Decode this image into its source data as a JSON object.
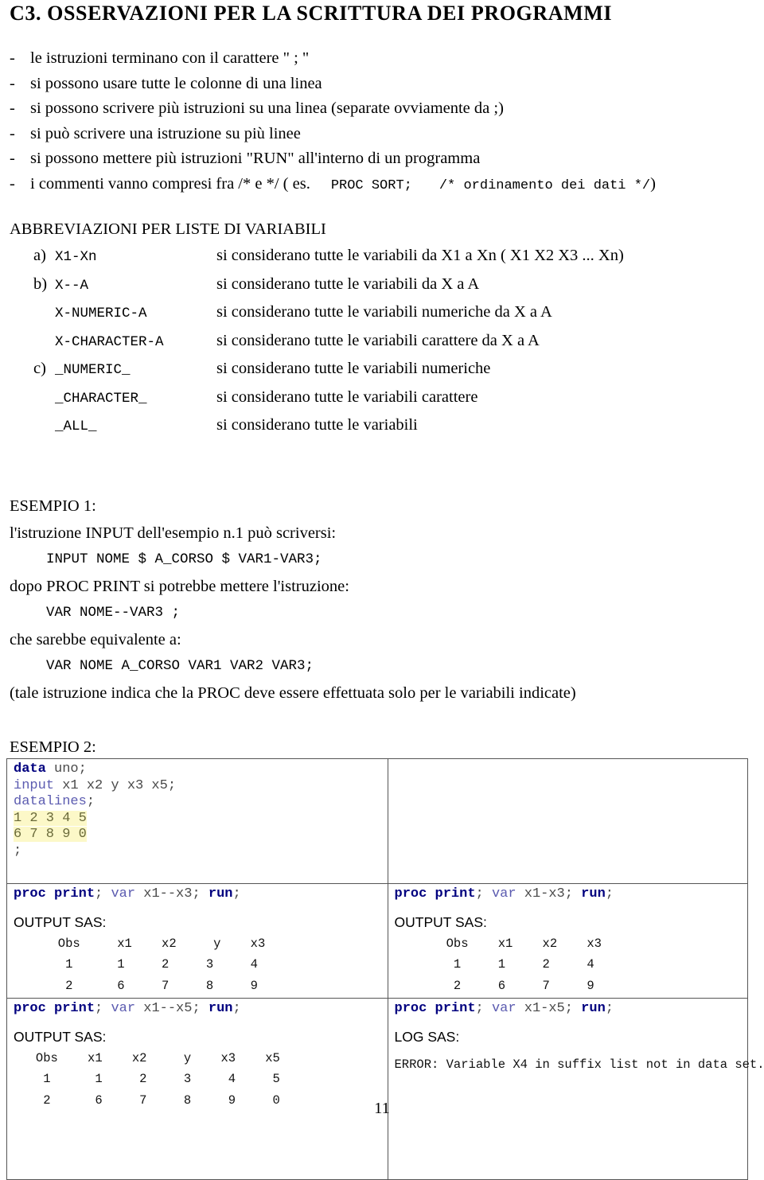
{
  "document": {
    "title": "C3. OSSERVAZIONI PER LA SCRITTURA DEI PROGRAMMI",
    "page_number": "11"
  },
  "bullets": {
    "dash": "-",
    "items": [
      {
        "text": "le istruzioni terminano con il carattere \" ; \""
      },
      {
        "text": "si possono usare tutte le colonne di una linea"
      },
      {
        "text": "si possono scrivere più istruzioni su una linea (separate ovviamente da ;)"
      },
      {
        "text": "si può scrivere una istruzione su più linee"
      },
      {
        "text": "si possono mettere più istruzioni \"RUN\" all'interno di un programma"
      }
    ],
    "comment_item": {
      "prefix": "i commenti vanno compresi fra /* e */ ( es.",
      "code": "PROC SORT;",
      "comment": "/* ordinamento dei dati */",
      "suffix": ")"
    }
  },
  "abbreviations": {
    "heading": "ABBREVIAZIONI PER LISTE DI VARIABILI",
    "rows": [
      {
        "marker": "a)",
        "code": "X1-Xn",
        "desc": "si considerano tutte le variabili da X1 a Xn    ( X1 X2 X3 ... Xn)"
      },
      {
        "marker": "b)",
        "code": "X--A",
        "desc": "si considerano tutte le variabili da X a A"
      },
      {
        "marker": "",
        "code": "X-NUMERIC-A",
        "desc": "si considerano tutte le variabili numeriche da X a A"
      },
      {
        "marker": "",
        "code": "X-CHARACTER-A",
        "desc": "si considerano tutte le variabili carattere da X a A"
      },
      {
        "marker": "c)",
        "code": "_NUMERIC_",
        "desc": "si considerano tutte le variabili numeriche"
      },
      {
        "marker": "",
        "code": "_CHARACTER_",
        "desc": "si considerano tutte le variabili carattere"
      },
      {
        "marker": "",
        "code": "_ALL_",
        "desc": "si considerano tutte le variabili"
      }
    ]
  },
  "esempio1": {
    "label": "ESEMPIO 1:",
    "line1": "l'istruzione INPUT dell'esempio n.1  può scriversi:",
    "code1": "INPUT NOME $ A_CORSO $ VAR1-VAR3;",
    "line2": "dopo PROC PRINT si potrebbe mettere l'istruzione:",
    "code2": "VAR NOME--VAR3 ;",
    "line3": "che sarebbe equivalente a:",
    "code3": "VAR NOME A_CORSO VAR1 VAR2 VAR3;",
    "line4": "(tale istruzione indica che la PROC deve essere effettuata solo per le variabili indicate)"
  },
  "esempio2": {
    "label": "ESEMPIO 2:",
    "left": {
      "data_step": {
        "kw_data": "data",
        "dataset": " uno;",
        "kw_input": "input",
        "input_vars": " x1 x2 y x3 x5;",
        "kw_datalines": "datalines",
        "datalines_semi": ";",
        "data_rows": [
          "1 2 3 4 5",
          "6 7 8 9 0"
        ],
        "terminator": ";"
      },
      "proc1": {
        "kw1": "proc print",
        "semi1": "; ",
        "kw_var": "var",
        "args": " x1--x3; ",
        "kw_run": "run",
        "semi2": ";"
      },
      "output1_label": "OUTPUT SAS:",
      "output1_header": "      Obs     x1    x2     y    x3",
      "output1_rows": [
        "       1      1     2     3     4",
        "       2      6     7     8     9"
      ],
      "proc2": {
        "kw1": "proc print",
        "semi1": "; ",
        "kw_var": "var",
        "args": " x1--x5; ",
        "kw_run": "run",
        "semi2": ";"
      },
      "output2_label": "OUTPUT SAS:",
      "output2_header": "   Obs    x1    x2     y    x3    x5",
      "output2_rows": [
        "    1      1     2     3     4     5",
        "    2      6     7     8     9     0"
      ]
    },
    "right": {
      "proc1": {
        "kw1": "proc print",
        "semi1": "; ",
        "kw_var": "var",
        "args": " x1-x3; ",
        "kw_run": "run",
        "semi2": ";"
      },
      "output1_label": "OUTPUT SAS:",
      "output1_header": "       Obs    x1    x2    x3",
      "output1_rows": [
        "        1     1     2     4",
        "        2     6     7     9"
      ],
      "proc2": {
        "kw1": "proc print",
        "semi1": "; ",
        "kw_var": "var",
        "args": " x1-x5; ",
        "kw_run": "run",
        "semi2": ";"
      },
      "log_label": "LOG SAS:",
      "log_message": "ERROR: Variable X4 in suffix list not in data set."
    }
  },
  "colors": {
    "keyword": "#00007f",
    "identifier": "#4a4a4a",
    "blue_token": "#5b5bb0",
    "highlight_bg": "#fcf8c8",
    "border": "#555555"
  }
}
